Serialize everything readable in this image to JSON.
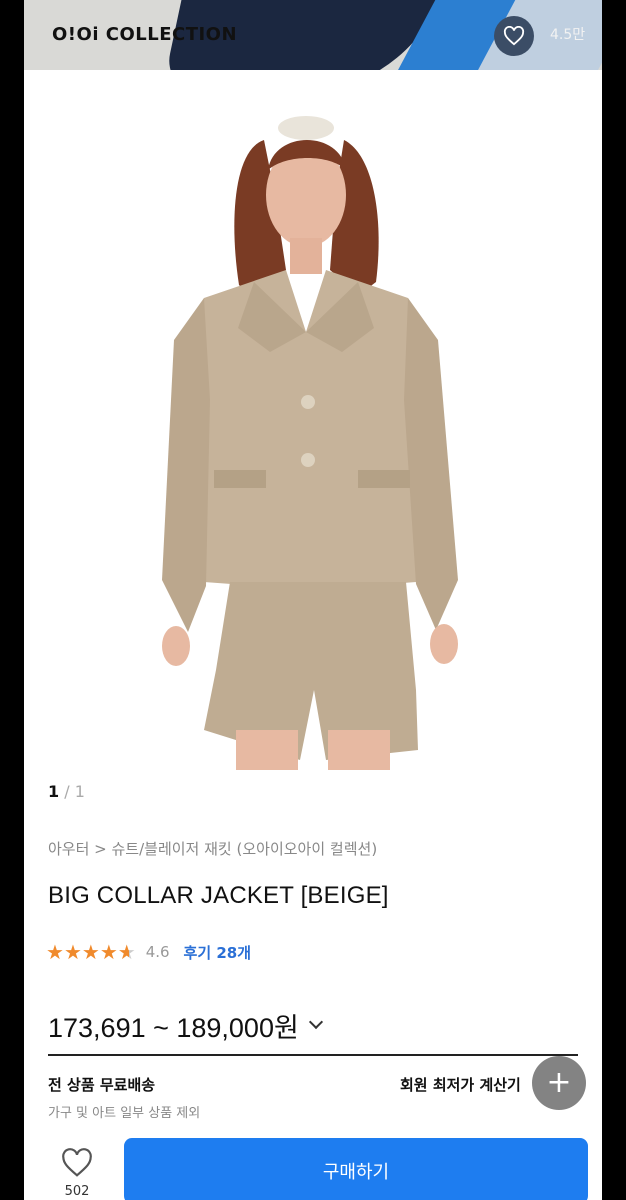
{
  "brand_banner": {
    "brand_name": "O!Oi COLLECTION",
    "like_count": "4.5만"
  },
  "gallery": {
    "current": "1",
    "separator": "/",
    "total": "1"
  },
  "product": {
    "category_path": "아우터 > 슈트/블레이저 재킷 (오아이오아이 컬렉션)",
    "title": "BIG COLLAR JACKET [BEIGE]",
    "rating": "4.6",
    "rating_stars": 4.6,
    "review_label": "후기 28개",
    "price": "173,691 ~ 189,000원"
  },
  "shipping": {
    "main": "전 상품 무료배송",
    "note": "가구 및 아트 일부 상품 제외",
    "calc_label": "회원 최저가 계산기"
  },
  "bottom_bar": {
    "wish_count": "502",
    "buy_label": "구매하기"
  },
  "colors": {
    "accent_blue": "#1e7df0",
    "star_orange": "#f08a2c",
    "review_blue": "#2a6fd6"
  }
}
